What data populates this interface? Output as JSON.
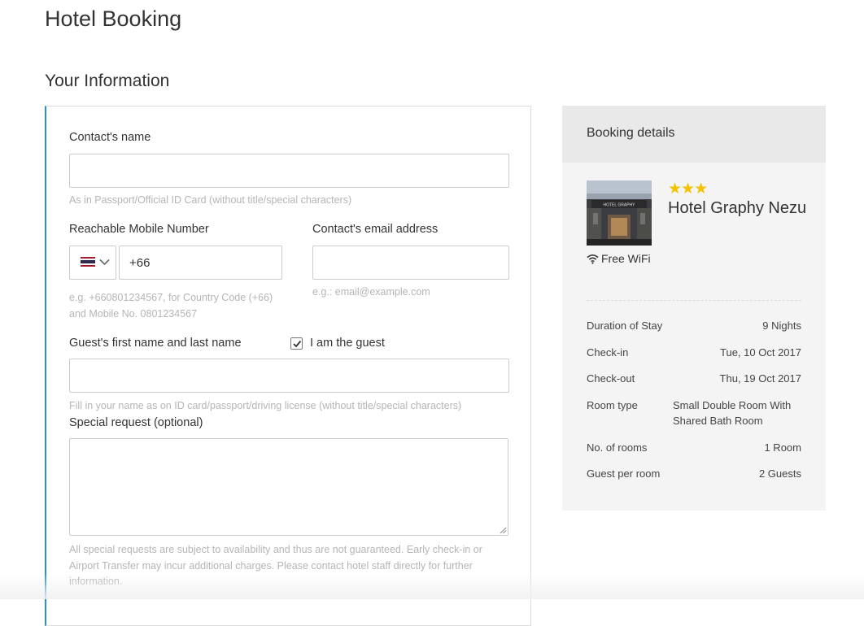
{
  "page": {
    "title": "Hotel Booking",
    "section_title": "Your Information"
  },
  "form": {
    "contact_name": {
      "label": "Contact's name",
      "value": "",
      "help": "As in Passport/Official ID Card (without title/special characters)"
    },
    "mobile": {
      "label": "Reachable Mobile Number",
      "country_flag": "thailand-flag-icon",
      "value": "+66",
      "help_line1": "e.g. +660801234567, for Country Code (+66)",
      "help_line2": "and Mobile No. 0801234567"
    },
    "email": {
      "label": "Contact's email address",
      "value": "",
      "help": "e.g.: email@example.com"
    },
    "guest_name": {
      "label": "Guest's first name and last name",
      "value": "",
      "help": "Fill in your name as on ID card/passport/driving license (without title/special characters)"
    },
    "i_am_guest": {
      "label": "I am the guest",
      "checked": true
    },
    "special_request": {
      "label": "Special request (optional)",
      "value": "",
      "help_line1": "All special requests are subject to availability and thus are not guaranteed. Early check-in or",
      "help_line2": "Airport Transfer may incur additional charges. Please contact hotel staff directly for further",
      "help_line3": "information."
    }
  },
  "booking": {
    "title": "Booking details",
    "hotel": {
      "stars": "★★★",
      "name": "Hotel Graphy Nezu",
      "image_sign": "HOTEL GRAPHY",
      "amenity": "Free WiFi"
    },
    "details": [
      {
        "label": "Duration of Stay",
        "value": "9 Nights"
      },
      {
        "label": "Check-in",
        "value": "Tue, 10 Oct 2017"
      },
      {
        "label": "Check-out",
        "value": "Thu, 19 Oct 2017"
      },
      {
        "label": "Room type",
        "value": "Small Double Room With Shared Bath Room"
      },
      {
        "label": "No. of rooms",
        "value": "1 Room"
      },
      {
        "label": "Guest per room",
        "value": "2 Guests"
      }
    ]
  },
  "colors": {
    "accent_border": "#2a90d6",
    "star": "#f3c200",
    "help_text": "#b5b5b5",
    "panel_bg": "#f4f4f4",
    "panel_header_bg": "#e9e9e9"
  }
}
